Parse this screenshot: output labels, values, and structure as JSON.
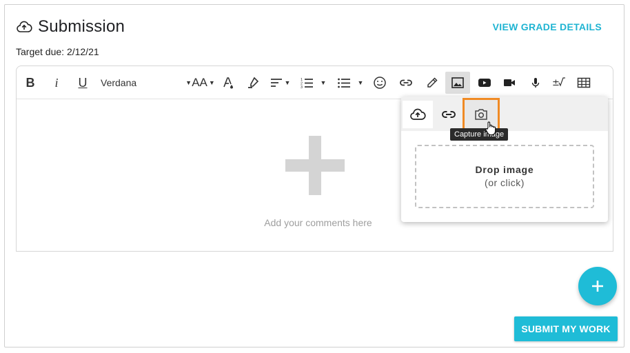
{
  "header": {
    "title": "Submission",
    "title_icon": "cloud-upload-icon",
    "due_text": "Target due: 2/12/21",
    "grade_link": "VIEW GRADE DETAILS"
  },
  "toolbar": {
    "bold": "B",
    "italic": "i",
    "underline": "U",
    "font_family": "Verdana",
    "font_size_label": "AA",
    "items": [
      "bold",
      "italic",
      "underline",
      "font-family",
      "font-size",
      "text-color",
      "highlight",
      "align",
      "numbered-list",
      "bulleted-list",
      "emoji",
      "link",
      "draw",
      "image",
      "video",
      "record-video",
      "record-audio",
      "math",
      "table"
    ],
    "active_item": "image"
  },
  "editor": {
    "placeholder": "Add your comments here"
  },
  "image_popup": {
    "tabs": [
      "upload",
      "link",
      "capture-image"
    ],
    "tooltip": "Capture image",
    "drop_title": "Drop image",
    "drop_subtitle": "(or click)"
  },
  "actions": {
    "fab_icon": "plus-icon",
    "submit_label": "SUBMIT MY WORK"
  },
  "colors": {
    "accent": "#1fbcd7",
    "highlight": "#f08a24",
    "tooltip_bg": "#2b2b2b"
  }
}
